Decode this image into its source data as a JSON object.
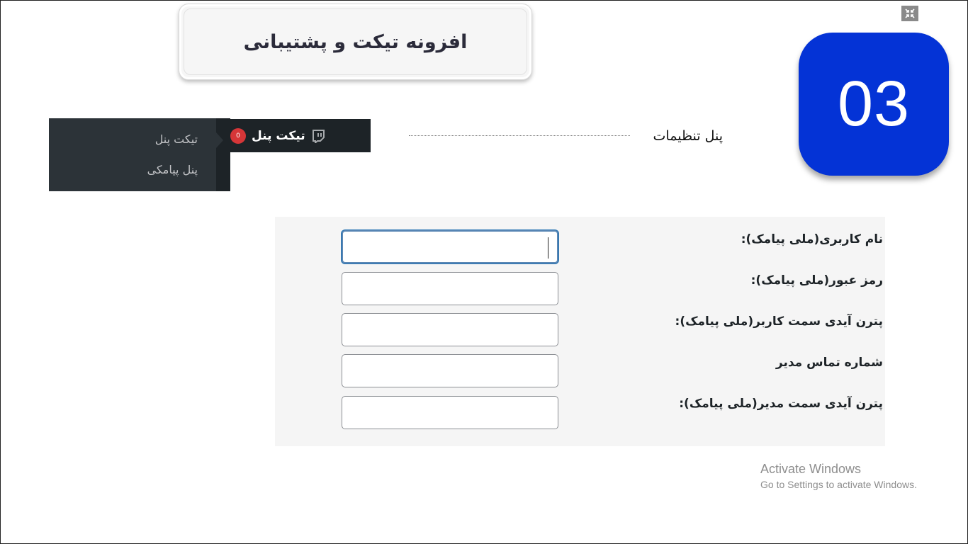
{
  "slide": {
    "title": "افزونه تیکت و پشتیبانی",
    "number": "03",
    "settings_label": "پنل تنظیمات"
  },
  "admin_menu": {
    "label": "تیکت پنل",
    "notification_count": "0",
    "submenu": [
      "تیکت پنل",
      "پنل پیامکی"
    ]
  },
  "form": {
    "fields": [
      {
        "label": "نام کاربری(ملی پیامک):",
        "value": ""
      },
      {
        "label": "رمز عبور(ملی پیامک):",
        "value": ""
      },
      {
        "label": "پترن آیدی سمت کاربر(ملی پیامک):",
        "value": ""
      },
      {
        "label": "شماره تماس مدیر",
        "value": ""
      },
      {
        "label": "پترن آیدی سمت مدیر(ملی پیامک):",
        "value": ""
      }
    ]
  },
  "watermark": {
    "line1": "Activate Windows",
    "line2": "Go to Settings to activate Windows."
  },
  "colors": {
    "badge": "#0433d6",
    "admin_menu_bg": "#1d2327",
    "notification": "#d63638",
    "form_bg": "#f5f5f5"
  },
  "icons": [
    "exit-fullscreen-icon",
    "twitch-icon"
  ]
}
